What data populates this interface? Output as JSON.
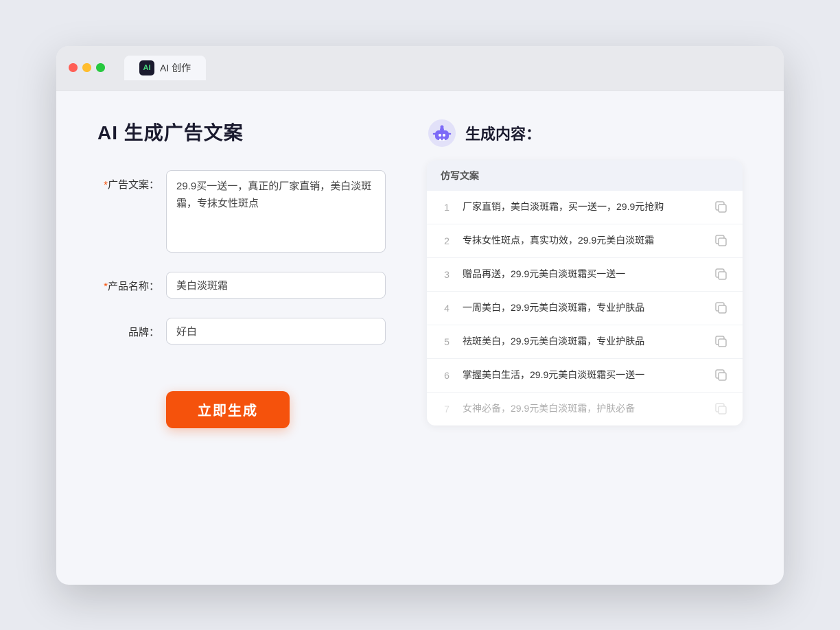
{
  "browser": {
    "tab_label": "AI 创作",
    "tab_icon_text": "AI"
  },
  "left_panel": {
    "page_title": "AI 生成广告文案",
    "form": {
      "ad_copy_label": "广告文案：",
      "ad_copy_required": "*",
      "ad_copy_value": "29.9买一送一，真正的厂家直销，美白淡斑霜，专抹女性斑点",
      "product_name_label": "产品名称：",
      "product_name_required": "*",
      "product_name_value": "美白淡斑霜",
      "brand_label": "品牌：",
      "brand_value": "好白"
    },
    "generate_button": "立即生成"
  },
  "right_panel": {
    "result_title": "生成内容：",
    "table_header": "仿写文案",
    "results": [
      {
        "num": "1",
        "text": "厂家直销，美白淡斑霜，买一送一，29.9元抢购",
        "faded": false
      },
      {
        "num": "2",
        "text": "专抹女性斑点，真实功效，29.9元美白淡斑霜",
        "faded": false
      },
      {
        "num": "3",
        "text": "赠品再送，29.9元美白淡斑霜买一送一",
        "faded": false
      },
      {
        "num": "4",
        "text": "一周美白，29.9元美白淡斑霜，专业护肤品",
        "faded": false
      },
      {
        "num": "5",
        "text": "祛斑美白，29.9元美白淡斑霜，专业护肤品",
        "faded": false
      },
      {
        "num": "6",
        "text": "掌握美白生活，29.9元美白淡斑霜买一送一",
        "faded": false
      },
      {
        "num": "7",
        "text": "女神必备，29.9元美白淡斑霜，护肤必备",
        "faded": true
      }
    ]
  }
}
